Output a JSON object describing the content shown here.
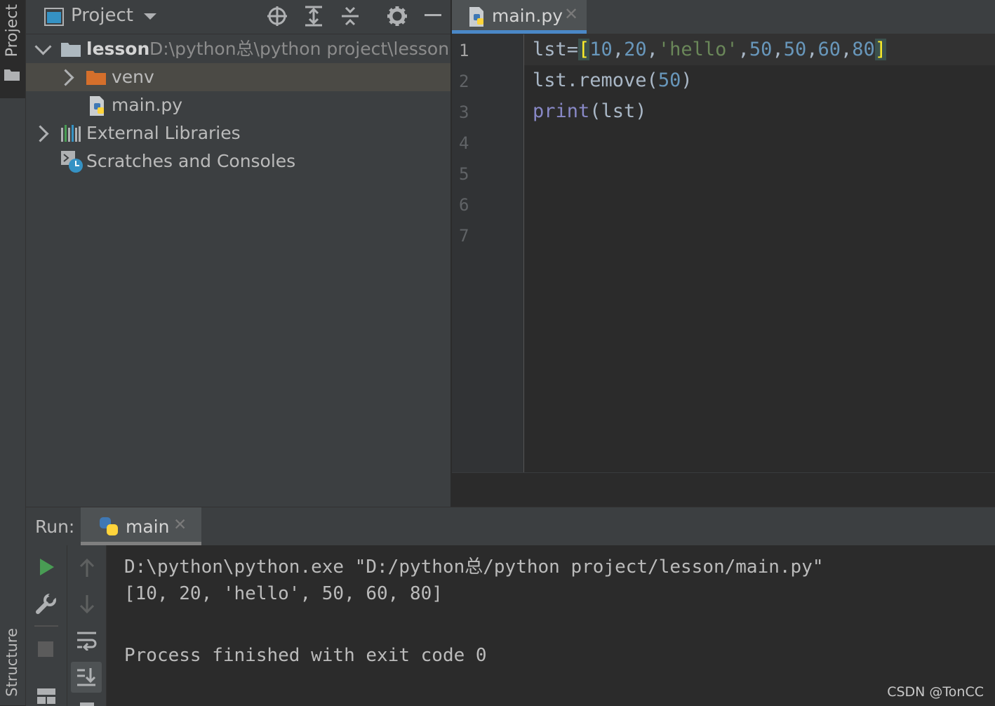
{
  "sidebar": {
    "project_tab": "Project",
    "structure_tab": "Structure"
  },
  "project_panel": {
    "title": "Project",
    "tree": [
      {
        "label": "lesson",
        "path": "D:\\python总\\python project\\lesson",
        "icon": "folder-icon",
        "expanded": true
      },
      {
        "label": "venv",
        "icon": "folder-icon",
        "expanded": false
      },
      {
        "label": "main.py",
        "icon": "python-file-icon"
      },
      {
        "label": "External Libraries",
        "icon": "libraries-icon",
        "expanded": false
      },
      {
        "label": "Scratches and Consoles",
        "icon": "scratches-icon"
      }
    ]
  },
  "editor": {
    "tab_label": "main.py",
    "line_numbers": [
      "1",
      "2",
      "3",
      "4",
      "5",
      "6",
      "7"
    ],
    "code": {
      "l1_var": "lst=",
      "l1_open": "[",
      "l1_n1": "10",
      "l1_n2": "20",
      "l1_s": "'hello'",
      "l1_n3": "50",
      "l1_n4": "50",
      "l1_n5": "60",
      "l1_n6": "80",
      "l1_close": "]",
      "comma": ",",
      "l2_a": "lst.remove(",
      "l2_n": "50",
      "l2_b": ")",
      "l3_kw": "print",
      "l3_b": "(lst)"
    }
  },
  "run_panel": {
    "label": "Run:",
    "tab_label": "main",
    "output": [
      "D:\\python\\python.exe \"D:/python总/python project/lesson/main.py\"",
      "[10, 20, 'hello', 50, 60, 80]",
      "",
      "Process finished with exit code 0"
    ]
  },
  "watermark": "CSDN @TonCC",
  "colors": {
    "background": "#2b2b2b",
    "panel": "#3c3f41",
    "selection": "#4b4a45",
    "accent": "#4a88c7",
    "number": "#6897bb",
    "string": "#6a8759",
    "keyword": "#8888c6",
    "run_green": "#499c54"
  }
}
